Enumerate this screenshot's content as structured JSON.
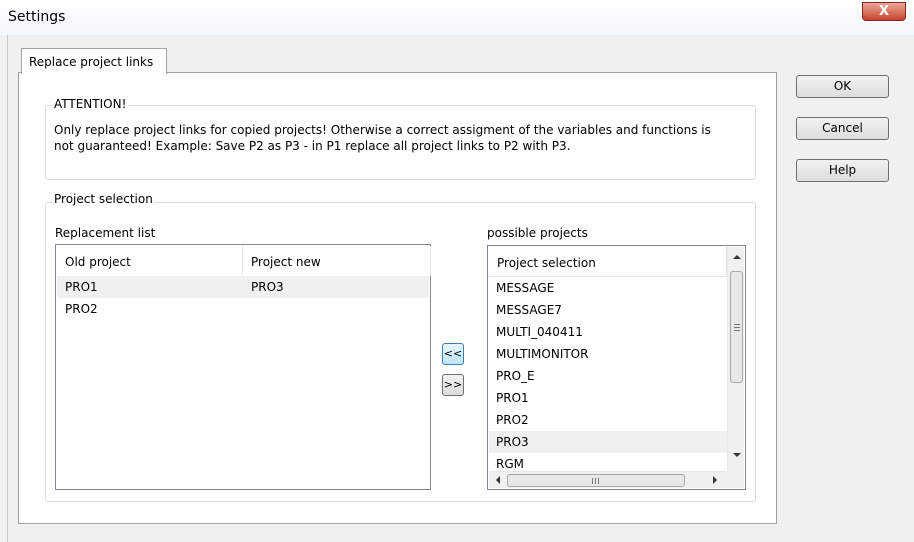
{
  "window": {
    "title": "Settings",
    "close_glyph": "X"
  },
  "tabs": [
    {
      "label": "Replace project links",
      "active": true
    }
  ],
  "attention": {
    "caption": "ATTENTION!",
    "line1": "Only replace project links for copied projects! Otherwise a correct assigment of the variables and functions is",
    "line2": "not guaranteed! Example: Save P2 as P3 - in P1 replace all project links to P2 with P3."
  },
  "project_selection": {
    "caption": "Project selection",
    "replacement_list": {
      "label": "Replacement list",
      "columns": [
        "Old project",
        "Project new"
      ],
      "rows": [
        {
          "old": "PRO1",
          "new": "PRO3",
          "selected": true
        },
        {
          "old": "PRO2",
          "new": "",
          "selected": false
        }
      ]
    },
    "buttons": {
      "add": "<<",
      "remove": ">>"
    },
    "possible_projects": {
      "label": "possible projects",
      "column": "Project selection",
      "items": [
        "MESSAGE",
        "MESSAGE7",
        "MULTI_040411",
        "MULTIMONITOR",
        "PRO_E",
        "PRO1",
        "PRO2",
        "PRO3",
        "RGM"
      ],
      "selected": "PRO3"
    }
  },
  "dialog_buttons": {
    "ok": "OK",
    "cancel": "Cancel",
    "help": "Help"
  }
}
